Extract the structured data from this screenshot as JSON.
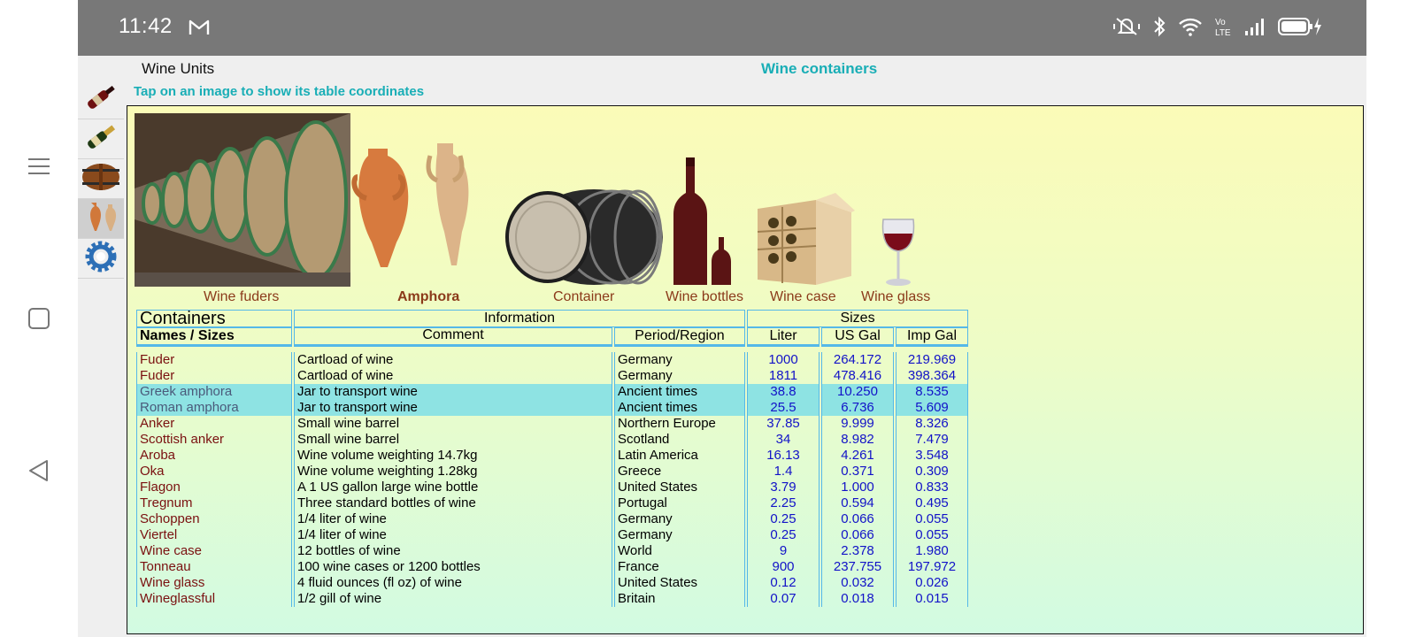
{
  "status_bar": {
    "time": "11:42"
  },
  "app": {
    "title": "Wine Units",
    "screen_title": "Wine containers",
    "hint": "Tap on an image to show its table coordinates"
  },
  "sidebar": {
    "items": [
      {
        "icon": "red-wine-bottle-icon"
      },
      {
        "icon": "champagne-bottle-icon"
      },
      {
        "icon": "barrel-icon"
      },
      {
        "icon": "amphora-icon",
        "active": true
      },
      {
        "icon": "settings-gear-icon"
      }
    ]
  },
  "images": [
    {
      "caption": "Wine fuders",
      "bold": false
    },
    {
      "caption": "Amphora",
      "bold": true
    },
    {
      "caption": "Container",
      "bold": false
    },
    {
      "caption": "Wine bottles",
      "bold": false
    },
    {
      "caption": "Wine case",
      "bold": false
    },
    {
      "caption": "Wine glass",
      "bold": false
    }
  ],
  "table": {
    "group_headers": {
      "containers": "Containers",
      "information": "Information",
      "sizes": "Sizes"
    },
    "column_headers": {
      "names": "Names / Sizes",
      "comment": "Comment",
      "region": "Period/Region",
      "liter": "Liter",
      "usgal": "US Gal",
      "impgal": "Imp Gal"
    },
    "rows": [
      {
        "name": "Fuder",
        "comment": "Cartload of wine",
        "region": "Germany",
        "liter": "1000",
        "usgal": "264.172",
        "impgal": "219.969",
        "highlight": false
      },
      {
        "name": "Fuder",
        "comment": "Cartload of wine",
        "region": "Germany",
        "liter": "1811",
        "usgal": "478.416",
        "impgal": "398.364",
        "highlight": false
      },
      {
        "name": "Greek amphora",
        "comment": "Jar to transport wine",
        "region": "Ancient times",
        "liter": "38.8",
        "usgal": "10.250",
        "impgal": "8.535",
        "highlight": true
      },
      {
        "name": "Roman amphora",
        "comment": "Jar to transport wine",
        "region": "Ancient times",
        "liter": "25.5",
        "usgal": "6.736",
        "impgal": "5.609",
        "highlight": true
      },
      {
        "name": "Anker",
        "comment": "Small wine barrel",
        "region": "Northern Europe",
        "liter": "37.85",
        "usgal": "9.999",
        "impgal": "8.326",
        "highlight": false
      },
      {
        "name": "Scottish anker",
        "comment": "Small wine barrel",
        "region": "Scotland",
        "liter": "34",
        "usgal": "8.982",
        "impgal": "7.479",
        "highlight": false
      },
      {
        "name": "Aroba",
        "comment": "Wine volume weighting 14.7kg",
        "region": "Latin America",
        "liter": "16.13",
        "usgal": "4.261",
        "impgal": "3.548",
        "highlight": false
      },
      {
        "name": "Oka",
        "comment": "Wine volume weighting 1.28kg",
        "region": "Greece",
        "liter": "1.4",
        "usgal": "0.371",
        "impgal": "0.309",
        "highlight": false
      },
      {
        "name": "Flagon",
        "comment": "A 1 US gallon large wine bottle",
        "region": "United States",
        "liter": "3.79",
        "usgal": "1.000",
        "impgal": "0.833",
        "highlight": false
      },
      {
        "name": "Tregnum",
        "comment": "Three standard bottles of wine",
        "region": "Portugal",
        "liter": "2.25",
        "usgal": "0.594",
        "impgal": "0.495",
        "highlight": false
      },
      {
        "name": "Schoppen",
        "comment": "1/4 liter of wine",
        "region": "Germany",
        "liter": "0.25",
        "usgal": "0.066",
        "impgal": "0.055",
        "highlight": false
      },
      {
        "name": "Viertel",
        "comment": "1/4 liter of wine",
        "region": "Germany",
        "liter": "0.25",
        "usgal": "0.066",
        "impgal": "0.055",
        "highlight": false
      },
      {
        "name": "Wine case",
        "comment": "12 bottles of wine",
        "region": "World",
        "liter": "9",
        "usgal": "2.378",
        "impgal": "1.980",
        "highlight": false
      },
      {
        "name": "Tonneau",
        "comment": "100 wine cases or 1200 bottles",
        "region": "France",
        "liter": "900",
        "usgal": "237.755",
        "impgal": "197.972",
        "highlight": false
      },
      {
        "name": "Wine glass",
        "comment": "4 fluid ounces (fl oz) of wine",
        "region": "United States",
        "liter": "0.12",
        "usgal": "0.032",
        "impgal": "0.026",
        "highlight": false
      },
      {
        "name": "Wineglassful",
        "comment": "1/2 gill of wine",
        "region": "Britain",
        "liter": "0.07",
        "usgal": "0.018",
        "impgal": "0.015",
        "highlight": false
      }
    ]
  }
}
